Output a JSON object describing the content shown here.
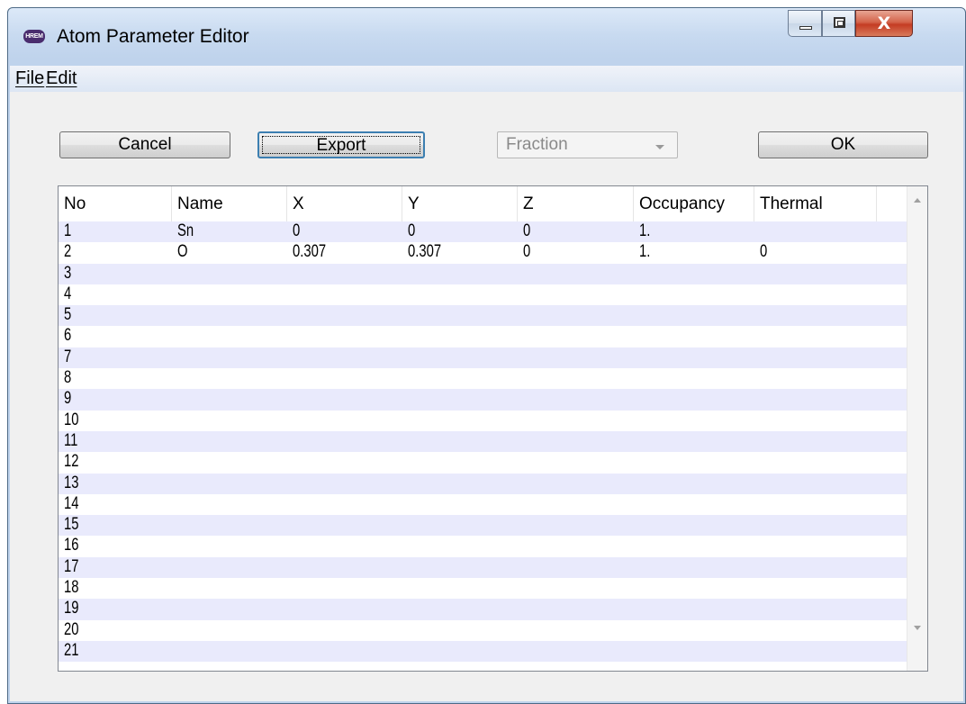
{
  "window": {
    "title": "Atom Parameter Editor",
    "icon_text": "HREM",
    "close_glyph": "X"
  },
  "menu": {
    "file": "File",
    "edit": "Edit"
  },
  "toolbar": {
    "cancel": "Cancel",
    "export": "Export",
    "coord_mode": "Fraction",
    "ok": "OK"
  },
  "columns": [
    "No",
    "Name",
    "X",
    "Y",
    "Z",
    "Occupancy",
    "Thermal"
  ],
  "rows": [
    [
      "1",
      "Sn",
      "0",
      "0",
      "0",
      "1.",
      ""
    ],
    [
      "2",
      "O",
      "0.307",
      "0.307",
      "0",
      "1.",
      "0"
    ],
    [
      "3",
      "",
      "",
      "",
      "",
      "",
      ""
    ],
    [
      "4",
      "",
      "",
      "",
      "",
      "",
      ""
    ],
    [
      "5",
      "",
      "",
      "",
      "",
      "",
      ""
    ],
    [
      "6",
      "",
      "",
      "",
      "",
      "",
      ""
    ],
    [
      "7",
      "",
      "",
      "",
      "",
      "",
      ""
    ],
    [
      "8",
      "",
      "",
      "",
      "",
      "",
      ""
    ],
    [
      "9",
      "",
      "",
      "",
      "",
      "",
      ""
    ],
    [
      "10",
      "",
      "",
      "",
      "",
      "",
      ""
    ],
    [
      "11",
      "",
      "",
      "",
      "",
      "",
      ""
    ],
    [
      "12",
      "",
      "",
      "",
      "",
      "",
      ""
    ],
    [
      "13",
      "",
      "",
      "",
      "",
      "",
      ""
    ],
    [
      "14",
      "",
      "",
      "",
      "",
      "",
      ""
    ],
    [
      "15",
      "",
      "",
      "",
      "",
      "",
      ""
    ],
    [
      "16",
      "",
      "",
      "",
      "",
      "",
      ""
    ],
    [
      "17",
      "",
      "",
      "",
      "",
      "",
      ""
    ],
    [
      "18",
      "",
      "",
      "",
      "",
      "",
      ""
    ],
    [
      "19",
      "",
      "",
      "",
      "",
      "",
      ""
    ],
    [
      "20",
      "",
      "",
      "",
      "",
      "",
      ""
    ],
    [
      "21",
      "",
      "",
      "",
      "",
      "",
      ""
    ]
  ],
  "colors": {
    "row_alt": "#e9eafc",
    "row": "#ffffff",
    "close_button": "#c43c23",
    "titlebar": "#c8daf0"
  }
}
